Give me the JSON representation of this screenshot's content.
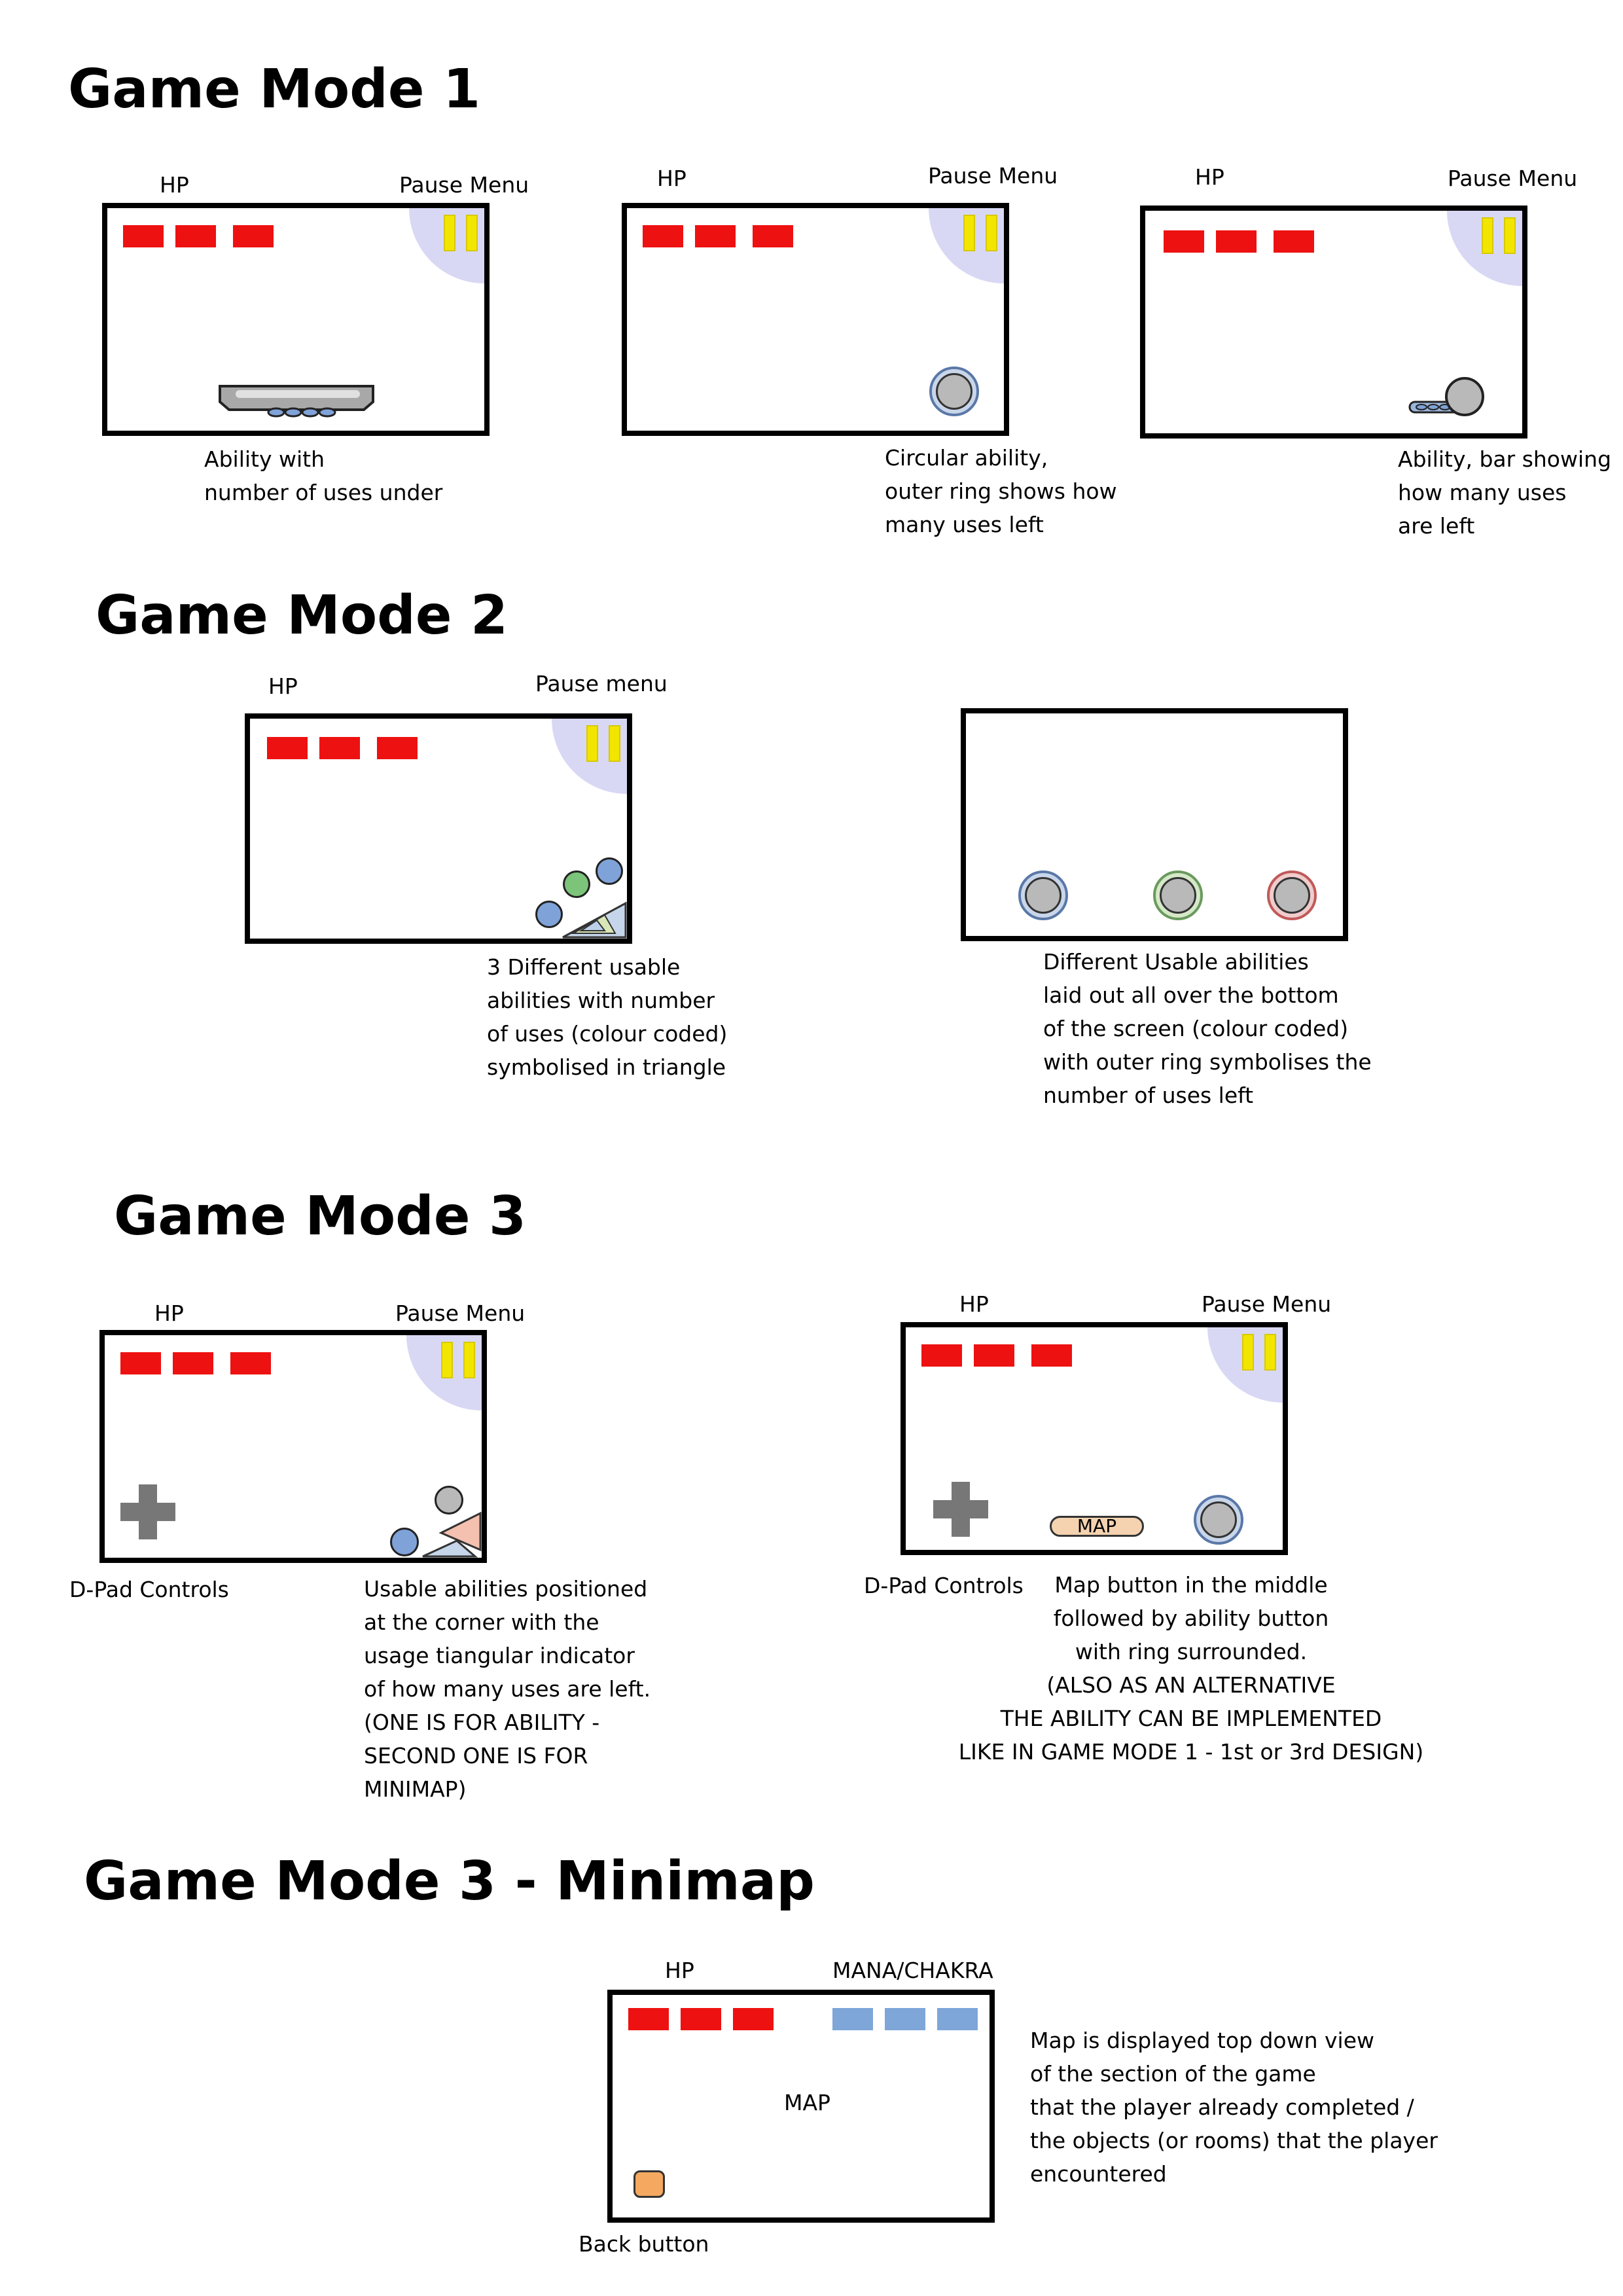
{
  "sections": {
    "gm1": {
      "title": "Game Mode 1",
      "screens": [
        {
          "hp_label": "HP",
          "pause_label": "Pause Menu",
          "caption": [
            "Ability with",
            "number of uses under"
          ]
        },
        {
          "hp_label": "HP",
          "pause_label": "Pause Menu",
          "caption": [
            "Circular ability,",
            "outer ring shows how",
            "many uses left"
          ]
        },
        {
          "hp_label": "HP",
          "pause_label": "Pause Menu",
          "caption": [
            "Ability, bar showing",
            "how many uses",
            "are left"
          ]
        }
      ]
    },
    "gm2": {
      "title": "Game Mode 2",
      "screens": [
        {
          "hp_label": "HP",
          "pause_label": "Pause menu",
          "caption": [
            "3 Different usable",
            "abilities with number",
            "of uses (colour coded)",
            "symbolised in triangle"
          ]
        },
        {
          "caption": [
            "Different Usable abilities",
            "laid out all over the bottom",
            "of the screen (colour coded)",
            "with outer ring symbolises the",
            "number of uses left"
          ]
        }
      ]
    },
    "gm3": {
      "title": "Game Mode 3",
      "screens": [
        {
          "hp_label": "HP",
          "pause_label": "Pause Menu",
          "dpad_label": "D-Pad Controls",
          "caption": [
            "Usable abilities positioned",
            "at the corner with the",
            "usage tiangular indicator",
            "of how many uses are left.",
            "(ONE IS FOR ABILITY -",
            "SECOND ONE IS FOR",
            "MINIMAP)"
          ]
        },
        {
          "hp_label": "HP",
          "pause_label": "Pause Menu",
          "dpad_label": "D-Pad Controls",
          "map_button": "MAP",
          "caption": [
            "Map button in the middle",
            "followed by ability button",
            "with ring surrounded.",
            "(ALSO AS AN ALTERNATIVE",
            "THE ABILITY CAN BE IMPLEMENTED",
            "LIKE IN GAME MODE 1 - 1st or 3rd DESIGN)"
          ]
        }
      ]
    },
    "gm3map": {
      "title": "Game Mode 3 - Minimap",
      "hp_label": "HP",
      "mana_label": "MANA/CHAKRA",
      "map_label": "MAP",
      "back_label": "Back button",
      "caption": [
        "Map is displayed top down view",
        "of the section of the game",
        "that the player already completed /",
        "the objects (or rooms) that the player",
        "encountered"
      ]
    }
  },
  "colors": {
    "hp": "#ee1111",
    "mana": "#7ea6d8",
    "pause_bg": "#d8d8f4",
    "pause_bars": "#f2e600",
    "ability_blue": "#7fa2d8",
    "ability_green": "#7cc47a",
    "ability_red": "#e88a8a",
    "ability_grey": "#b9b9b9",
    "map_button": "#f5d3b0",
    "back_button": "#f4a860"
  }
}
